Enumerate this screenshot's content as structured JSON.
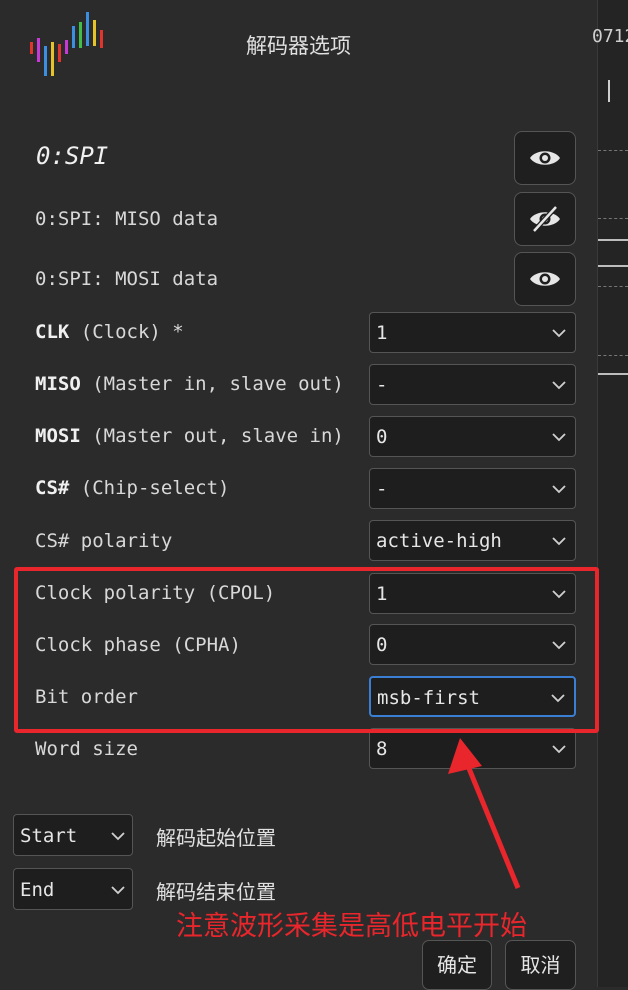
{
  "dialog": {
    "title": "解码器选项",
    "decoder_name": "0:SPI"
  },
  "rows": {
    "miso_data": "0:SPI: MISO data",
    "mosi_data": "0:SPI: MOSI data"
  },
  "options": {
    "clk": {
      "name": "CLK",
      "desc": " (Clock) *",
      "value": "1"
    },
    "miso": {
      "name": "MISO",
      "desc": " (Master in, slave out)",
      "value": "-"
    },
    "mosi": {
      "name": "MOSI",
      "desc": " (Master out, slave in)",
      "value": "0"
    },
    "cs": {
      "name": "CS#",
      "desc": " (Chip-select)",
      "value": "-"
    },
    "cs_polarity": {
      "label": "CS# polarity",
      "value": "active-high"
    },
    "cpol": {
      "label": "Clock polarity (CPOL)",
      "value": "1"
    },
    "cpha": {
      "label": "Clock phase (CPHA)",
      "value": "0"
    },
    "bit_order": {
      "label": "Bit order",
      "value": "msb-first"
    },
    "word_size": {
      "label": "Word size",
      "value": "8"
    }
  },
  "range": {
    "start_value": "Start",
    "start_label": "解码起始位置",
    "end_value": "End",
    "end_label": "解码结束位置"
  },
  "annotation": "注意波形采集是高低电平开始",
  "buttons": {
    "ok": "确定",
    "cancel": "取消"
  },
  "background": {
    "partial_text": "0712"
  },
  "icons": {
    "eye": "eye-icon",
    "eye_off": "eye-off-icon",
    "chevron": "chevron-down-icon"
  },
  "colors": {
    "highlight": "#e8262c",
    "focus": "#3b7fd4"
  }
}
